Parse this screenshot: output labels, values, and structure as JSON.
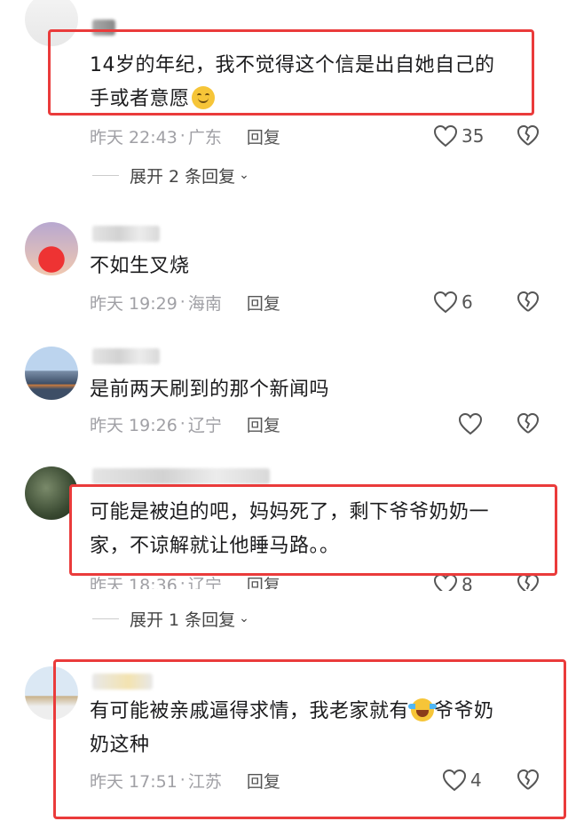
{
  "comments": [
    {
      "text_line1": "14岁的年纪，我不觉得这个信是出自她自己的",
      "text_line2": "手或者意愿",
      "time": "昨天 22:43",
      "location": "广东",
      "reply_label": "回复",
      "likes": "35",
      "expand_label": "展开 2 条回复"
    },
    {
      "text_line1": "不如生叉烧",
      "time": "昨天 19:29",
      "location": "海南",
      "reply_label": "回复",
      "likes": "6"
    },
    {
      "text_line1": "是前两天刷到的那个新闻吗",
      "time": "昨天 19:26",
      "location": "辽宁",
      "reply_label": "回复",
      "likes": ""
    },
    {
      "text_line1": "可能是被迫的吧，妈妈死了，剩下爷爷奶奶一",
      "text_line2": "家，不谅解就让他睡马路。。",
      "time": "昨天 18:36",
      "location": "辽宁",
      "reply_label": "回复",
      "likes": "8",
      "expand_label": "展开 1 条回复"
    },
    {
      "text_line1a": "有可能被亲戚逼得求情，我老家就有",
      "text_line1b": "爷爷奶",
      "text_line2": "奶这种",
      "time": "昨天 17:51",
      "location": "江苏",
      "reply_label": "回复",
      "likes": "4"
    }
  ],
  "icons": {
    "like": "heart-outline-icon",
    "dislike": "broken-heart-icon",
    "expand": "chevron-down-icon",
    "emoji_1": "smiling-face-emoji",
    "emoji_2": "crying-laughing-emoji"
  },
  "colors": {
    "highlight_box": "#ea3b3b",
    "meta_text": "#a0a0a5",
    "body_text": "#1c1c1e"
  }
}
